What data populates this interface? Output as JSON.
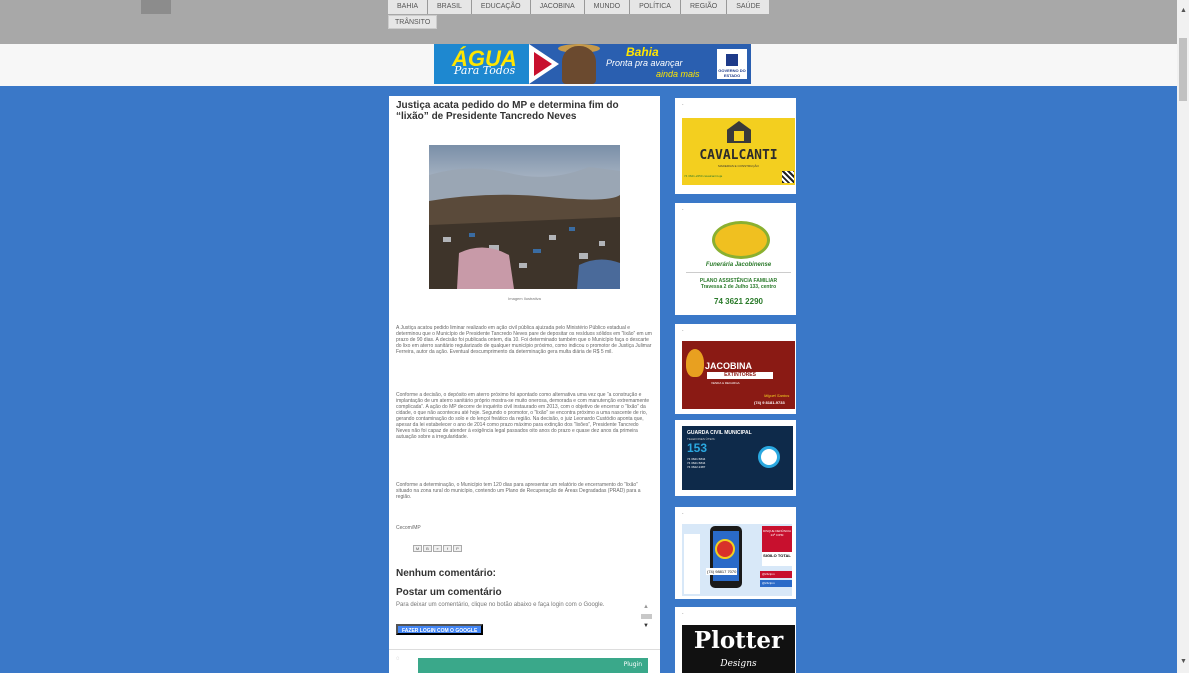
{
  "nav": {
    "items": [
      "BAHIA",
      "BRASIL",
      "EDUCAÇÃO",
      "JACOBINA",
      "MUNDO",
      "POLÍTICA",
      "REGIÃO",
      "SAÚDE"
    ],
    "second_row": "TRÂNSITO"
  },
  "banner": {
    "agua": "ÁGUA",
    "para_todos": "Para Todos",
    "bahia": "Bahia",
    "pronta": "Pronta pra avançar",
    "ainda": "ainda mais",
    "gov": "GOVERNO DO ESTADO"
  },
  "post": {
    "title": "Justiça acata pedido do MP e determina fim do “lixão” de Presidente Tancredo Neves",
    "caption": "Imagem Ilustrativa",
    "paragraphs": [
      "A Justiça acatou pedido liminar realizado em ação civil pública ajuizada pelo Ministério Público estadual e determinou que o Município de Presidente Tancredo Neves pare de depositar os resíduos sólidos em “lixão” em um prazo de 90 dias. A decisão foi publicada ontem, dia 10. Foi determinado também que o Município faça o descarte do lixo em aterro sanitário regularizado de qualquer município próximo, como indicou o promotor de Justiça Julimar Ferreira, autor da ação. Eventual descumprimento da determinação gera multa diária de R$ 5 mil.",
      "Conforme a decisão, o depósito em aterro próximo foi apontado como alternativa uma vez que “a construção e implantação de um aterro sanitário próprio mostra-se muito onerosa, demorada e com manutenção extremamente complicada”. A ação do MP decorre de inquérito civil instaurado em 2013, com o objetivo de encerrar o “lixão” da cidade, o que não aconteceu até hoje. Segundo o promotor, o “lixão” se encontra próximo a uma nascente de rio, gerando contaminação do solo e do lençol freático da região. Na decisão, o juiz Leonardo Custódio aponta que, apesar da lei estabelecer o ano de 2014 como prazo máximo para extinção dos “lixões”, Presidente Tancredo Neves não foi capaz de atender à exigência legal passados oito anos do prazo e quase dez anos da primeira autuação sobre a irregularidade.",
      "Conforme a determinação, o Município tem 120 dias para apresentar um relatório de encerramento do “lixão” situado na zona rural do município, contendo um Plano de Recuperação de Áreas Degradadas (PRAD) para a região.",
      "Cecom/MP"
    ],
    "share_icons": [
      "M",
      "B",
      "»",
      "f",
      "P"
    ],
    "no_comments": "Nenhum comentário:",
    "post_comment": "Postar um comentário",
    "comment_prompt": "Para deixar um comentário, clique no botão abaixo e faça login com o Google.",
    "login_button": "FAZER LOGIN COM O GOOGLE",
    "bottom_widget_text": "Plugin"
  },
  "sidebar": {
    "dot": ".",
    "cavalcanti": {
      "name": "CAVALCANTI",
      "sub": "MADEIRAS E CONSTRUÇÃO",
      "foot": "74 3621-2250   cavalcanti.loja"
    },
    "funeraria": {
      "name": "Funerária Jacobinense",
      "plan": "PLANO ASSISTÊNCIA FAMILIAR",
      "address": "Travessa 2 de Julho 133, centro",
      "phone": "74 3621 2290"
    },
    "extintores": {
      "brand": "JACOBINA",
      "band": "EXTINTORES",
      "sub": "VENDA & RECARGA",
      "owner": "Miguel Santos",
      "phone": "(74) 9 8181-9733"
    },
    "guarda": {
      "title": "GUARDA CIVIL MUNICIPAL",
      "sub": "TELEFONES ÚTEIS:",
      "big": "153",
      "numbers": [
        "74 3621.5844",
        "74 3621.5844",
        "74 3622.2487"
      ]
    },
    "cipm": {
      "tel": "(74) 98817 7070",
      "red": "DISQUE DENÚNCIA 24ª CIPM",
      "sigilo": "SIGILO TOTAL",
      "ig": "@24cipm",
      "fb": "@24cipm"
    },
    "plotter": {
      "name": "Plotter",
      "sub": "Designs"
    }
  },
  "scrollbar": {
    "up": "▲",
    "down": "▼"
  }
}
